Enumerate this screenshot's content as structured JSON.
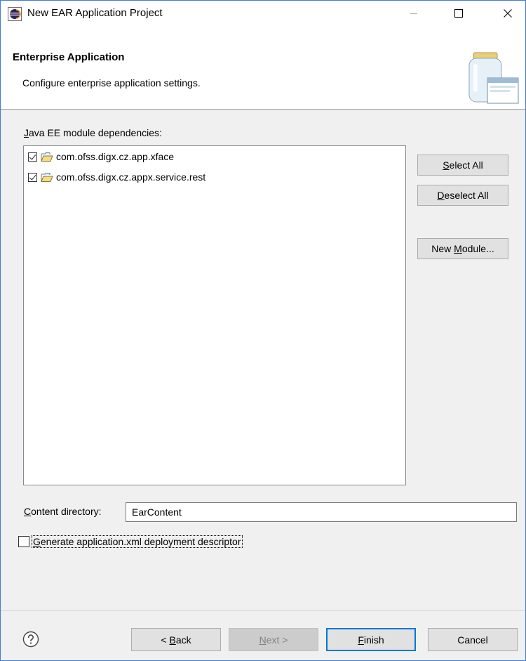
{
  "window": {
    "title": "New EAR Application Project",
    "icons": {
      "app": "eclipse-icon",
      "minimize": "minimize-icon",
      "maximize": "maximize-icon",
      "close": "close-icon"
    }
  },
  "banner": {
    "title": "Enterprise Application",
    "description": "Configure enterprise application settings.",
    "image": "jar-window-icon"
  },
  "dependencies": {
    "label_mnemonic": "J",
    "label_rest": "ava EE module dependencies:",
    "items": [
      {
        "name": "com.ofss.digx.cz.app.xface",
        "checked": true,
        "icon": "project-folder-icon"
      },
      {
        "name": "com.ofss.digx.cz.appx.service.rest",
        "checked": true,
        "icon": "project-folder-icon"
      }
    ]
  },
  "side_buttons": {
    "select_all": {
      "mnemonic": "S",
      "rest": "elect All"
    },
    "deselect_all": {
      "mnemonic": "D",
      "rest": "eselect All"
    },
    "new_module": {
      "before": "New ",
      "mnemonic": "M",
      "rest": "odule..."
    }
  },
  "content_directory": {
    "label_mnemonic": "C",
    "label_rest": "ontent directory:",
    "value": "EarContent"
  },
  "generate_descriptor": {
    "mnemonic": "G",
    "rest": "enerate application.xml deployment descriptor",
    "checked": false
  },
  "footer": {
    "help_icon": "help-icon",
    "back": {
      "before": "< ",
      "mnemonic": "B",
      "rest": "ack"
    },
    "next": {
      "mnemonic": "N",
      "rest": "ext >",
      "enabled": false
    },
    "finish": {
      "mnemonic": "F",
      "rest": "inish"
    },
    "cancel": {
      "label": "Cancel"
    }
  },
  "colors": {
    "accent": "#0078d7",
    "window_border": "#3b7dd8",
    "dialog_bg": "#f0f0f0"
  }
}
